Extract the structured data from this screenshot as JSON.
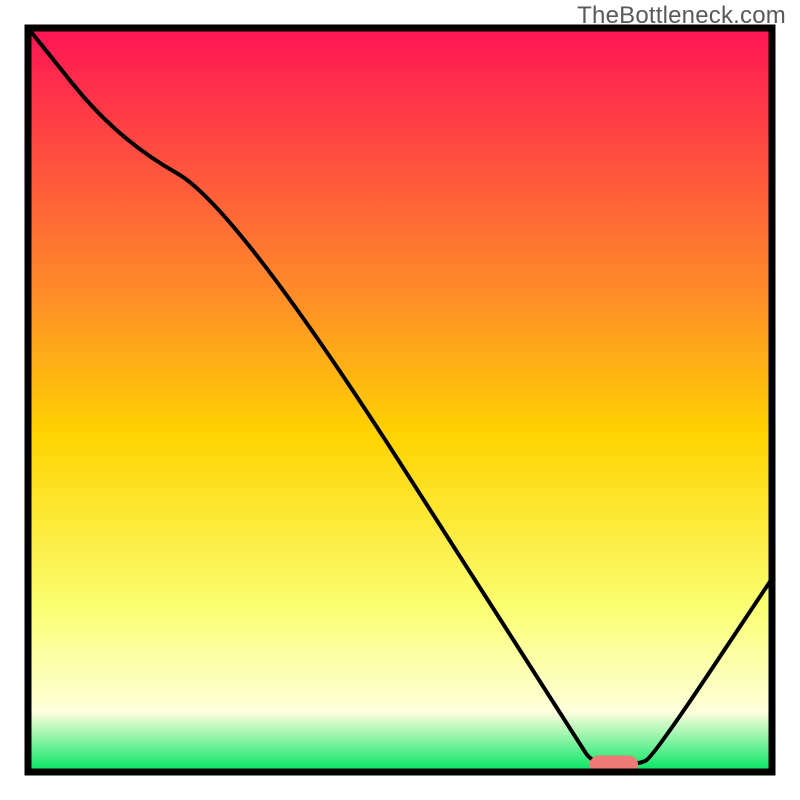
{
  "watermark": "TheBottleneck.com",
  "chart_data": {
    "type": "line",
    "title": "",
    "xlabel": "",
    "ylabel": "",
    "xlim": [
      0,
      100
    ],
    "ylim": [
      0,
      100
    ],
    "series": [
      {
        "name": "bottleneck-curve",
        "x": [
          0,
          12,
          28,
          74,
          76,
          82,
          84,
          100
        ],
        "values": [
          100,
          85,
          76,
          4,
          1,
          1,
          2,
          26
        ]
      }
    ],
    "marker": {
      "name": "target-range",
      "x_start": 75.5,
      "x_end": 82,
      "y": 1,
      "color": "#ee7a78"
    },
    "colors": {
      "gradient_top": "#ff1455",
      "gradient_upper_mid": "#ff8a2a",
      "gradient_mid": "#ffd400",
      "gradient_lower_mid": "#fbff72",
      "gradient_near_bottom": "#fdffdc",
      "gradient_bottom": "#00e562",
      "curve": "#000000",
      "frame": "#000000"
    }
  }
}
